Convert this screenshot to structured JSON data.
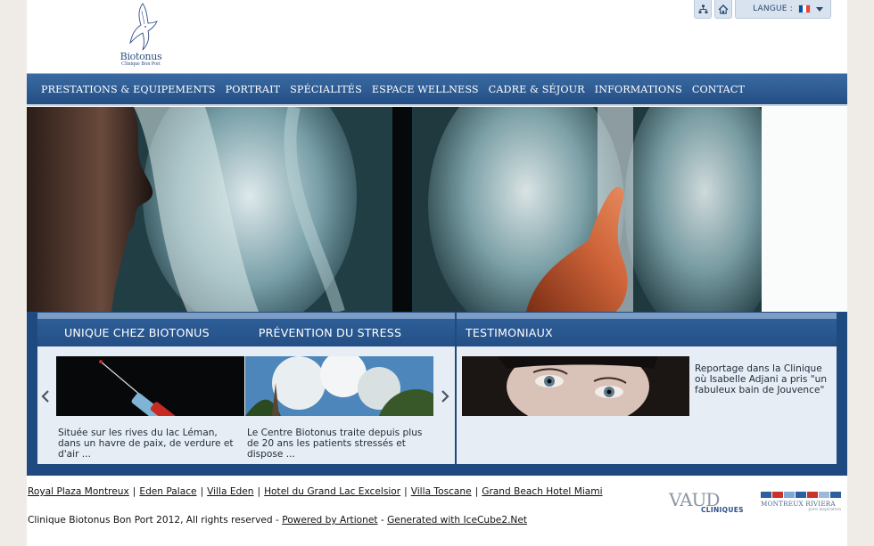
{
  "header": {
    "brand": "Biotonus",
    "subtitle": "Clinique Bon Port",
    "tools": {
      "sitemap_icon": "sitemap-icon",
      "home_icon": "home-icon",
      "language_label": "LANGUE :",
      "flag_colors": [
        "#0055a4",
        "#ffffff",
        "#ef4135"
      ]
    }
  },
  "nav": {
    "items": [
      "PRESTATIONS & EQUIPEMENTS",
      "PORTRAIT",
      "SPÉCIALITÉS",
      "ESPACE WELLNESS",
      "CADRE & SÉJOUR",
      "INFORMATIONS",
      "CONTACT"
    ]
  },
  "features": {
    "tabs": [
      "UNIQUE CHEZ BIOTONUS",
      "PRÉVENTION DU STRESS"
    ],
    "cards": [
      {
        "caption": "Située sur les rives du lac Léman, dans un havre de paix, de verdure et d'air ..."
      },
      {
        "caption": "Le Centre Biotonus traite depuis plus de 20 ans les patients stressés et dispose ..."
      }
    ],
    "prev_icon": "chevron-left-icon",
    "next_icon": "chevron-right-icon"
  },
  "testimonials": {
    "title": "TESTIMONIAUX",
    "text": "Reportage dans la Clinique où Isabelle Adjani a pris \"un fabuleux bain de Jouvence\""
  },
  "footer": {
    "links": [
      "Royal Plaza Montreux",
      "Eden Palace",
      "Villa Eden",
      "Hotel du Grand Lac Excelsior",
      "Villa Toscane",
      "Grand Beach Hotel Miami"
    ],
    "separator": "|",
    "copyright": "Clinique Biotonus Bon Port 2012, All rights reserved - ",
    "powered": "Powered by Artionet",
    "dash": " - ",
    "generated": "Generated with IceCube2.Net",
    "partner1": {
      "big": "VAUD",
      "small": "CLINIQUES"
    },
    "partner2": {
      "name": "MONTREUX RIVIERA",
      "tagline": "pure inspiration"
    }
  },
  "colors": {
    "nav_bg": "#2a568c",
    "band_bg": "#1f4a7f",
    "panel_bg": "#e7edf4",
    "accent": "#7b9dc6"
  }
}
